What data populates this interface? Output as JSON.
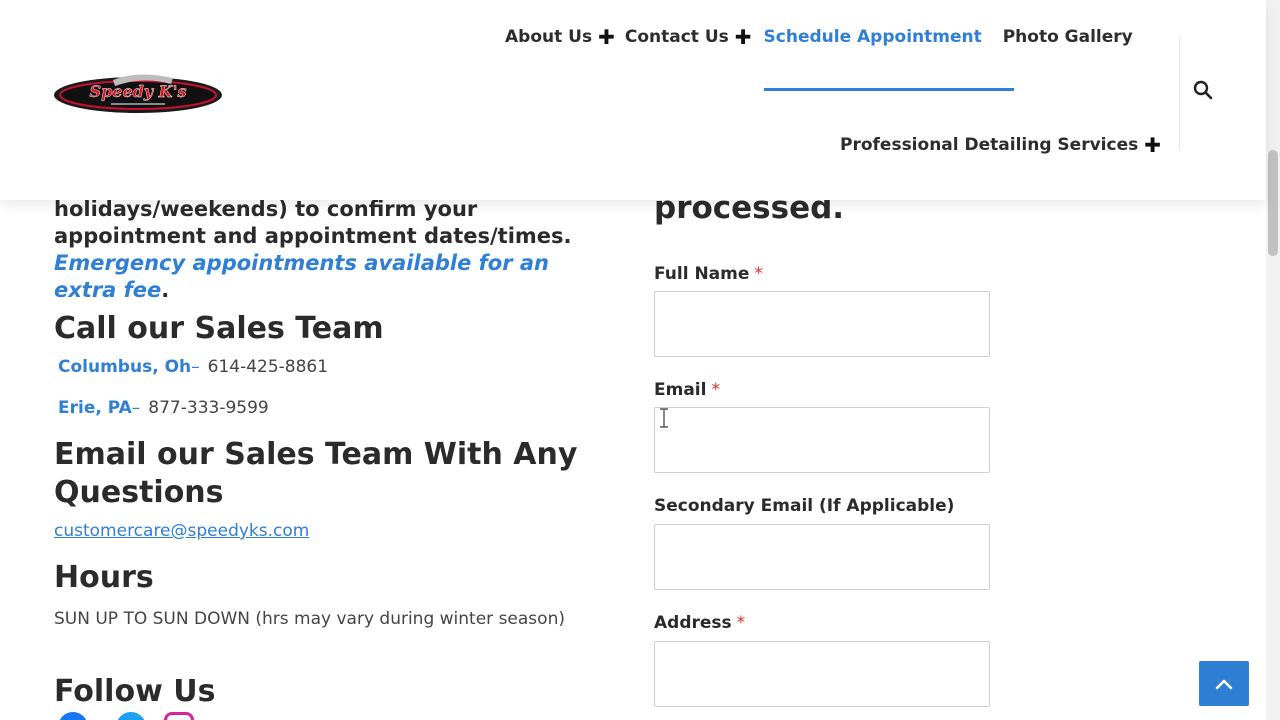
{
  "brand": {
    "logo_text": "Speedy K's"
  },
  "nav": {
    "about": "About Us",
    "contact": "Contact Us",
    "schedule": "Schedule Appointment",
    "gallery": "Photo Gallery",
    "services": "Professional Detailing Services",
    "accent_color": "#2f7fd4"
  },
  "left": {
    "intro_text": "holidays/weekends) to confirm your appointment and appointment dates/times. ",
    "intro_emphasis": "Emergency appointments available for an extra fee",
    "intro_end": ".",
    "call_heading": "Call our Sales Team",
    "contacts": [
      {
        "city": "Columbus, Oh",
        "dash": "–",
        "phone": "614-425-8861"
      },
      {
        "city": "Erie, PA",
        "dash": "–",
        "phone": "877-333-9599"
      }
    ],
    "email_heading": "Email our Sales Team With Any Questions",
    "email": "customercare@speedyks.com",
    "hours_heading": "Hours",
    "hours_text": "SUN UP TO SUN DOWN (hrs may vary during winter season)",
    "follow_heading": "Follow Us"
  },
  "form": {
    "heading_fragment": "processed.",
    "required_mark": "*",
    "fields": [
      {
        "label": "Full Name",
        "value": ""
      },
      {
        "label": "Email",
        "value": ""
      },
      {
        "label": "Secondary Email (If Applicable)",
        "value": ""
      },
      {
        "label": "Address",
        "value": ""
      }
    ]
  },
  "icons": {
    "search": "search-icon",
    "back_to_top": "chevron-up-icon",
    "plus": "plus-icon"
  }
}
